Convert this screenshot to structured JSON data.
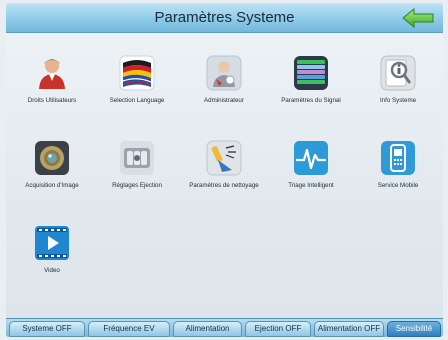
{
  "header": {
    "title": "Paramètres Systeme",
    "back_icon": "arrow-left-icon"
  },
  "grid": {
    "items": [
      {
        "label": "Droits Utilisateurs",
        "icon": "user-icon"
      },
      {
        "label": "Selection Language",
        "icon": "flags-icon"
      },
      {
        "label": "Administrateur",
        "icon": "admin-icon"
      },
      {
        "label": "Paramètres du Signal",
        "icon": "signal-icon"
      },
      {
        "label": "Info Systeme",
        "icon": "info-magnifier-icon"
      },
      {
        "label": "Acquisition d'Image",
        "icon": "camera-lens-icon"
      },
      {
        "label": "Réglages Ejection",
        "icon": "ejector-icon"
      },
      {
        "label": "Paramètres de nettoyage",
        "icon": "cleaning-icon"
      },
      {
        "label": "Triage Intelligent",
        "icon": "pulse-icon"
      },
      {
        "label": "Service Mobile",
        "icon": "mobile-phone-icon"
      },
      {
        "label": "Video",
        "icon": "video-play-icon"
      }
    ]
  },
  "bottom_tabs": [
    {
      "label": "Systeme OFF"
    },
    {
      "label": "Fréquence EV"
    },
    {
      "label": "Alimentation"
    },
    {
      "label": "Ejection OFF"
    },
    {
      "label": "Alimentation OFF"
    },
    {
      "label": "Sensibilité",
      "active": true
    }
  ],
  "colors": {
    "accent": "#2f7fbf",
    "title_bar": "#8ecbe9",
    "back_arrow": "#5cc43a"
  }
}
